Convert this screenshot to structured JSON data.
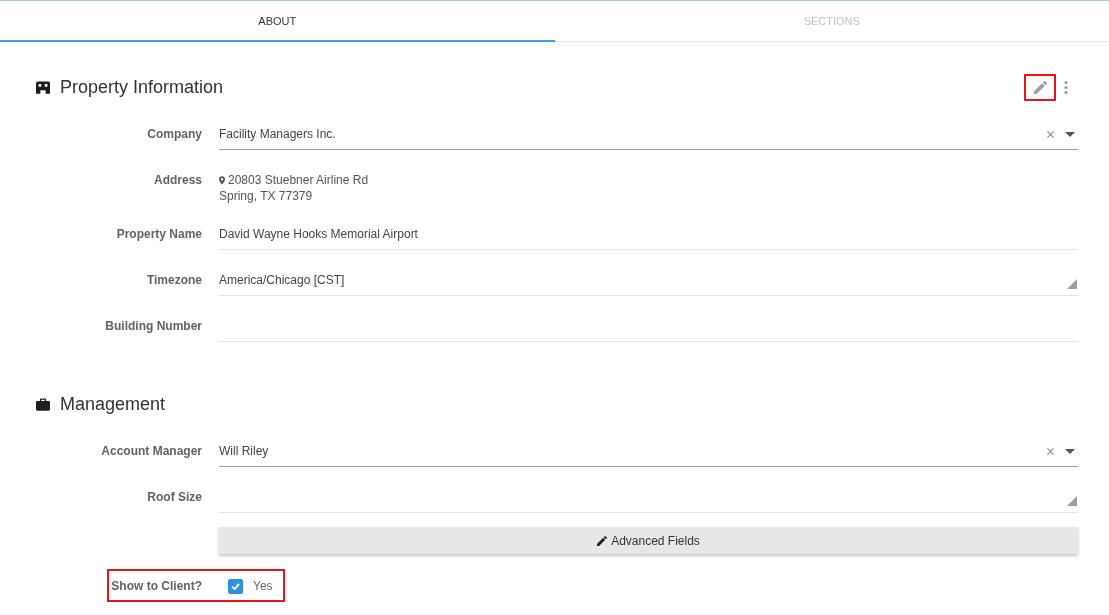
{
  "tabs": [
    {
      "label": "ABOUT",
      "selected": true
    },
    {
      "label": "SECTIONS",
      "selected": false
    }
  ],
  "sections": [
    {
      "kind": "property",
      "title": "Property Information",
      "actions": [
        {
          "kind": "edit",
          "highlighted": true
        },
        {
          "kind": "more"
        }
      ],
      "fields": [
        {
          "kind": "select",
          "label": "Company",
          "value": "Facility Managers Inc."
        },
        {
          "kind": "address",
          "label": "Address",
          "lines": [
            "20803 Stuebner Airline Rd",
            "Spring, TX 77379"
          ]
        },
        {
          "kind": "text",
          "label": "Property Name",
          "value": "David Wayne Hooks Memorial Airport"
        },
        {
          "kind": "resizable",
          "label": "Timezone",
          "value": "America/Chicago [CST]"
        },
        {
          "kind": "text",
          "label": "Building Number"
        }
      ]
    },
    {
      "kind": "management",
      "title": "Management",
      "fields": [
        {
          "kind": "select",
          "label": "Account Manager",
          "value": "Will Riley"
        },
        {
          "kind": "resizable",
          "label": "Roof Size"
        },
        {
          "kind": "button",
          "label": "Advanced Fields"
        },
        {
          "kind": "checkbox",
          "label": "Show to Client?",
          "option": "Yes",
          "checked": true,
          "highlighted": true
        }
      ]
    }
  ]
}
